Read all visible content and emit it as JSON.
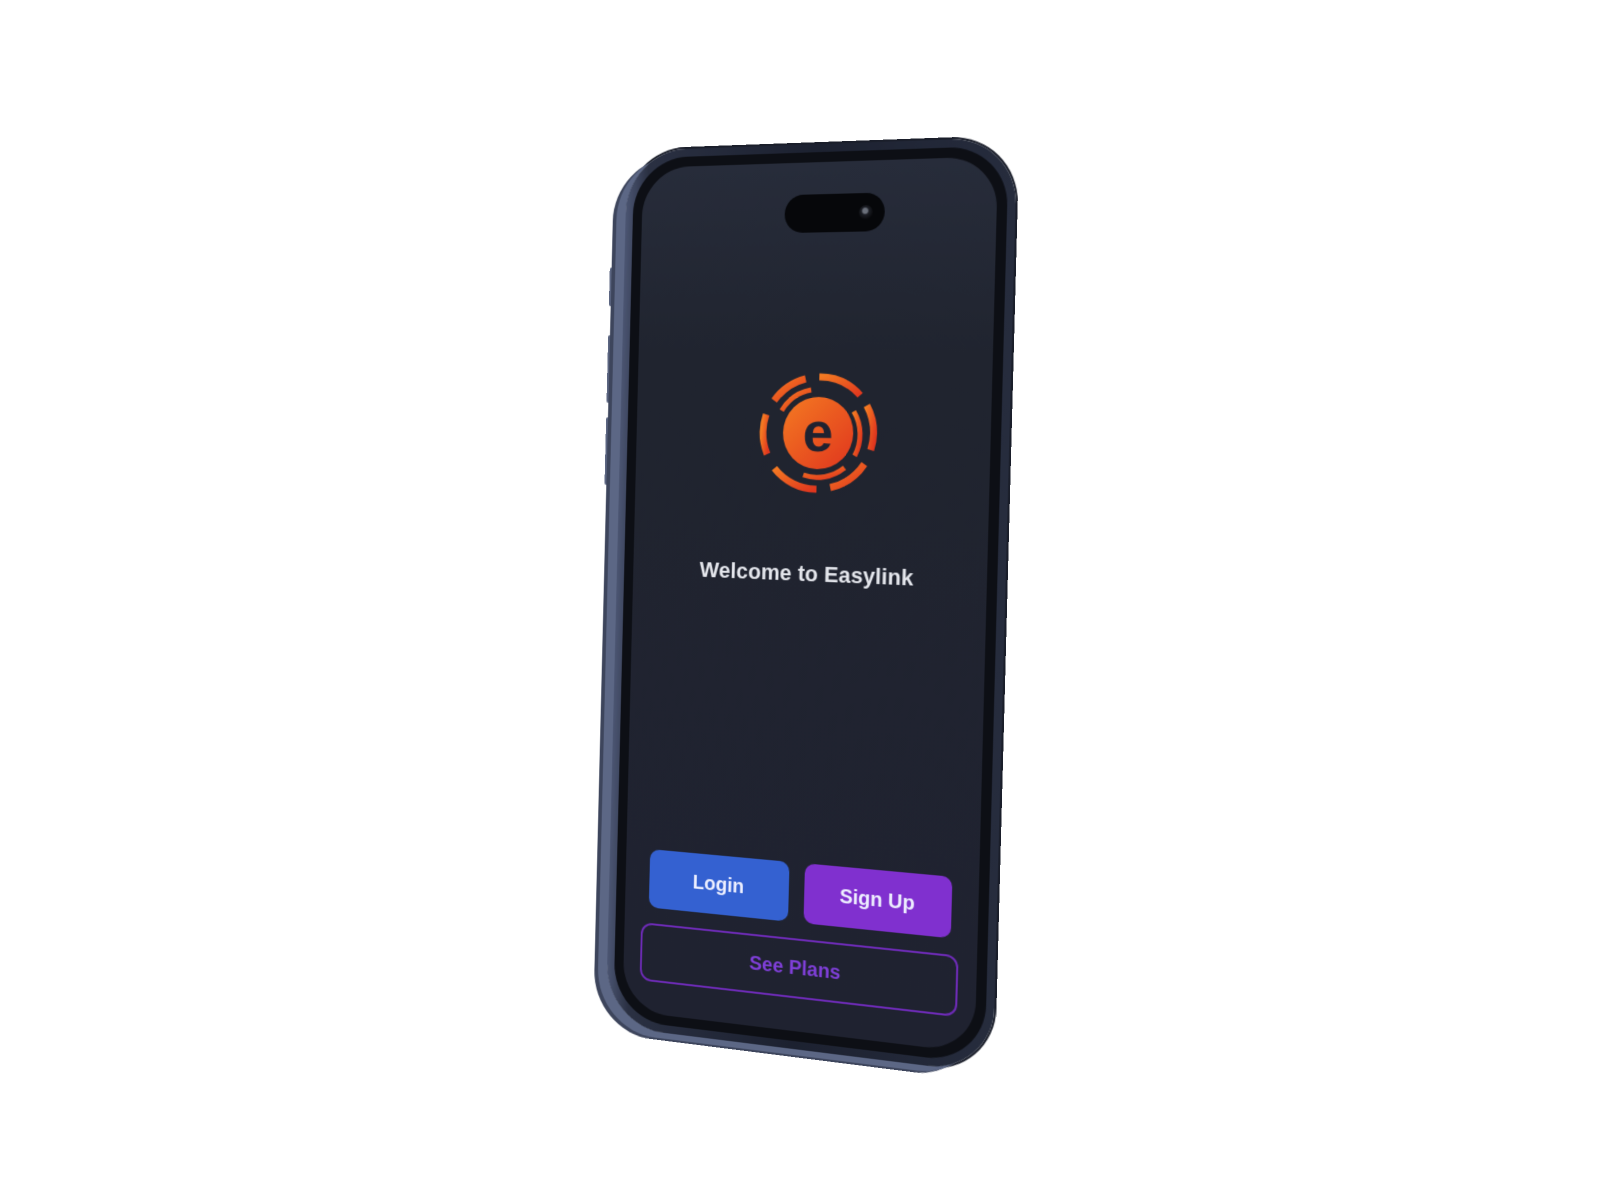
{
  "welcome": {
    "title": "Welcome to Easylink"
  },
  "actions": {
    "login_label": "Login",
    "signup_label": "Sign Up",
    "see_plans_label": "See Plans"
  },
  "logo": {
    "letter": "e",
    "icon": "easylink-logo-icon"
  },
  "colors": {
    "screen_bg": "#1f2230",
    "login": "#3461d1",
    "signup": "#8030cf",
    "see_plans_border": "#6d2bb6",
    "logo_orange": "#f26a1b",
    "logo_red": "#e0361e"
  }
}
